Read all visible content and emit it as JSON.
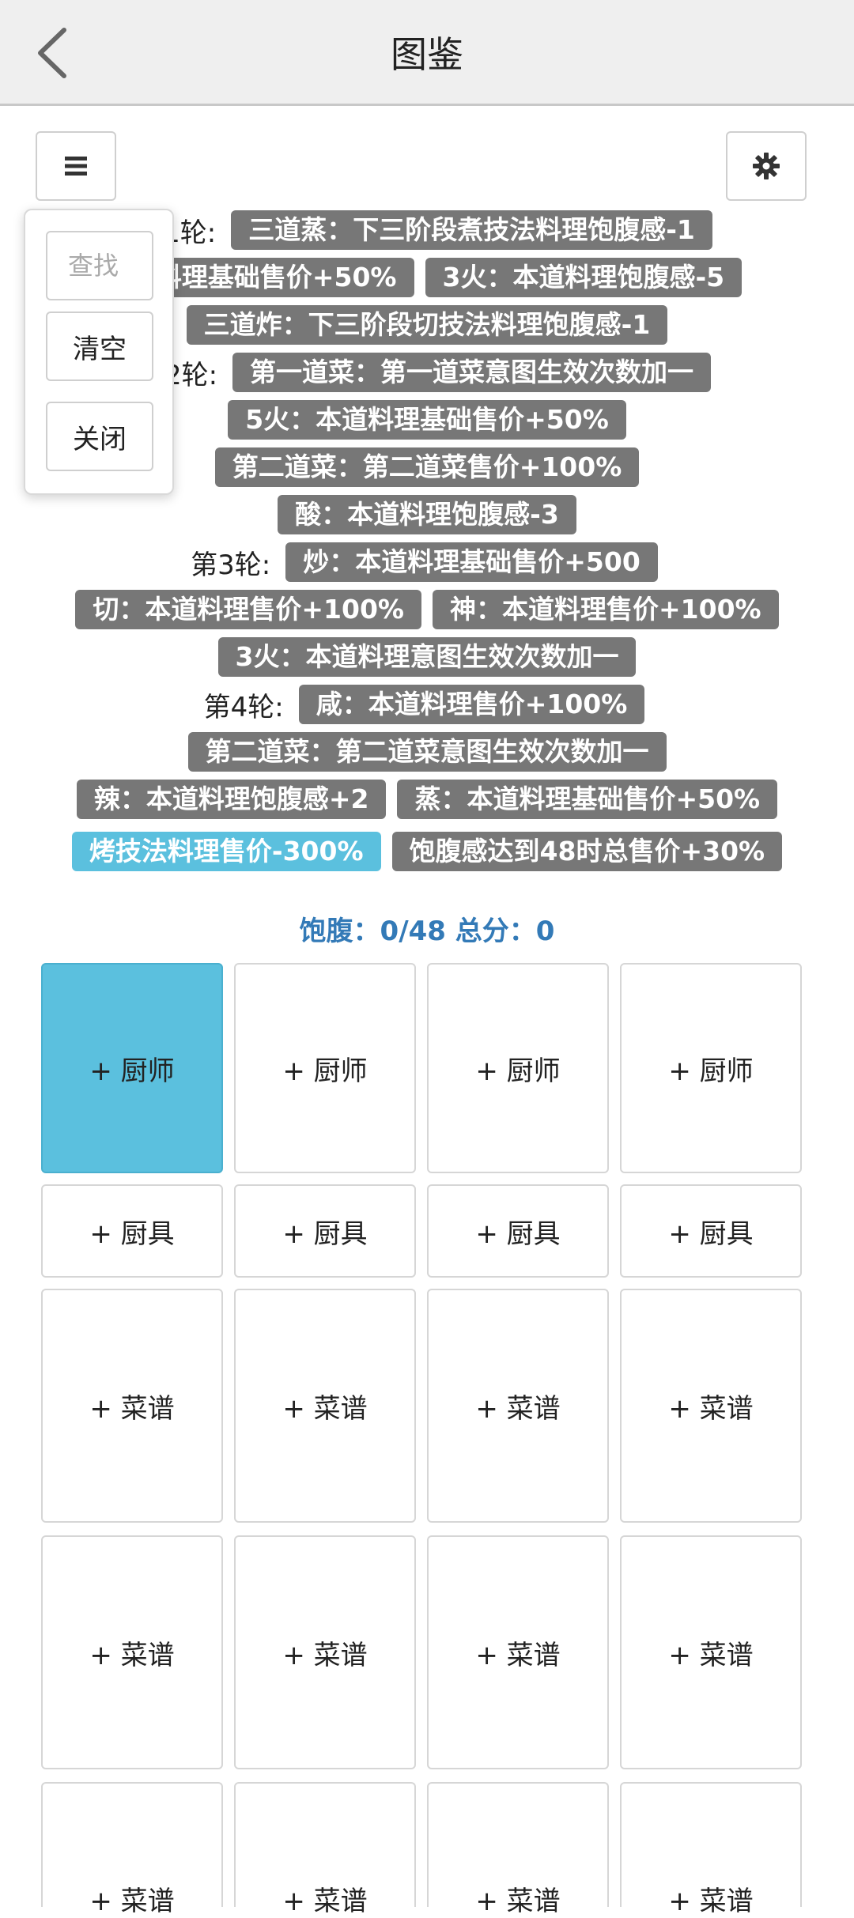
{
  "header": {
    "title": "图鉴"
  },
  "popup": {
    "search_placeholder": "查找",
    "clear_label": "清空",
    "close_label": "关闭"
  },
  "rounds": [
    {
      "label": "第1轮:",
      "lines": [
        [
          "三道蒸：下三阶段煮技法料理饱腹感-1"
        ],
        [
          "道料理基础售价+50%",
          "3火：本道料理饱腹感-5"
        ],
        [
          "三道炸：下三阶段切技法料理饱腹感-1"
        ]
      ]
    },
    {
      "label": "第2轮:",
      "lines": [
        [
          "第一道菜：第一道菜意图生效次数加一"
        ],
        [
          "5火：本道料理基础售价+50%"
        ],
        [
          "第二道菜：第二道菜售价+100%"
        ],
        [
          "酸：本道料理饱腹感-3"
        ]
      ]
    },
    {
      "label": "第3轮:",
      "lines": [
        [
          "炒：本道料理基础售价+500"
        ],
        [
          "切：本道料理售价+100%",
          "神：本道料理售价+100%"
        ],
        [
          "3火：本道料理意图生效次数加一"
        ]
      ]
    },
    {
      "label": "第4轮:",
      "lines": [
        [
          "咸：本道料理售价+100%"
        ],
        [
          "第二道菜：第二道菜意图生效次数加一"
        ],
        [
          "辣：本道料理饱腹感+2",
          "蒸：本道料理基础售价+50%"
        ]
      ]
    }
  ],
  "bonus_tags": [
    "烤技法料理售价-300%",
    "饱腹感达到48时总售价+30%"
  ],
  "summary": {
    "text": "饱腹：0/48 总分：0"
  },
  "slots": {
    "chef_label": "+ 厨师",
    "tool_label": "+ 厨具",
    "recipe_label": "+ 菜谱"
  },
  "colors": {
    "accent": "#5bc0de",
    "tag_gray": "#777777",
    "summary_blue": "#337ab7"
  }
}
